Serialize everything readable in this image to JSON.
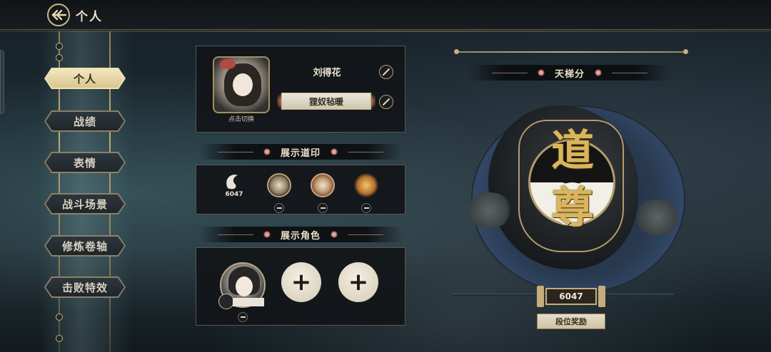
{
  "header": {
    "title": "个人"
  },
  "sidebar": {
    "items": [
      {
        "label": "个人",
        "active": true
      },
      {
        "label": "战绩",
        "active": false
      },
      {
        "label": "表情",
        "active": false
      },
      {
        "label": "战斗场景",
        "active": false
      },
      {
        "label": "修炼卷轴",
        "active": false
      },
      {
        "label": "击败特效",
        "active": false
      }
    ]
  },
  "profile": {
    "avatar_caption": "点击切换",
    "player_name": "刘得花",
    "title": "狸奴毡暖"
  },
  "seals": {
    "header": "展示道印",
    "first_count": "6047"
  },
  "characters": {
    "header": "展示角色"
  },
  "ladder": {
    "header": "天梯分",
    "rank_glyph_top": "道",
    "rank_glyph_bottom": "尊",
    "score": "6047",
    "reward_button": "段位奖励"
  },
  "colors": {
    "accent_gold": "#c7ad7a",
    "active_tab": "#e4d29d",
    "panel_bg": "#121518"
  }
}
